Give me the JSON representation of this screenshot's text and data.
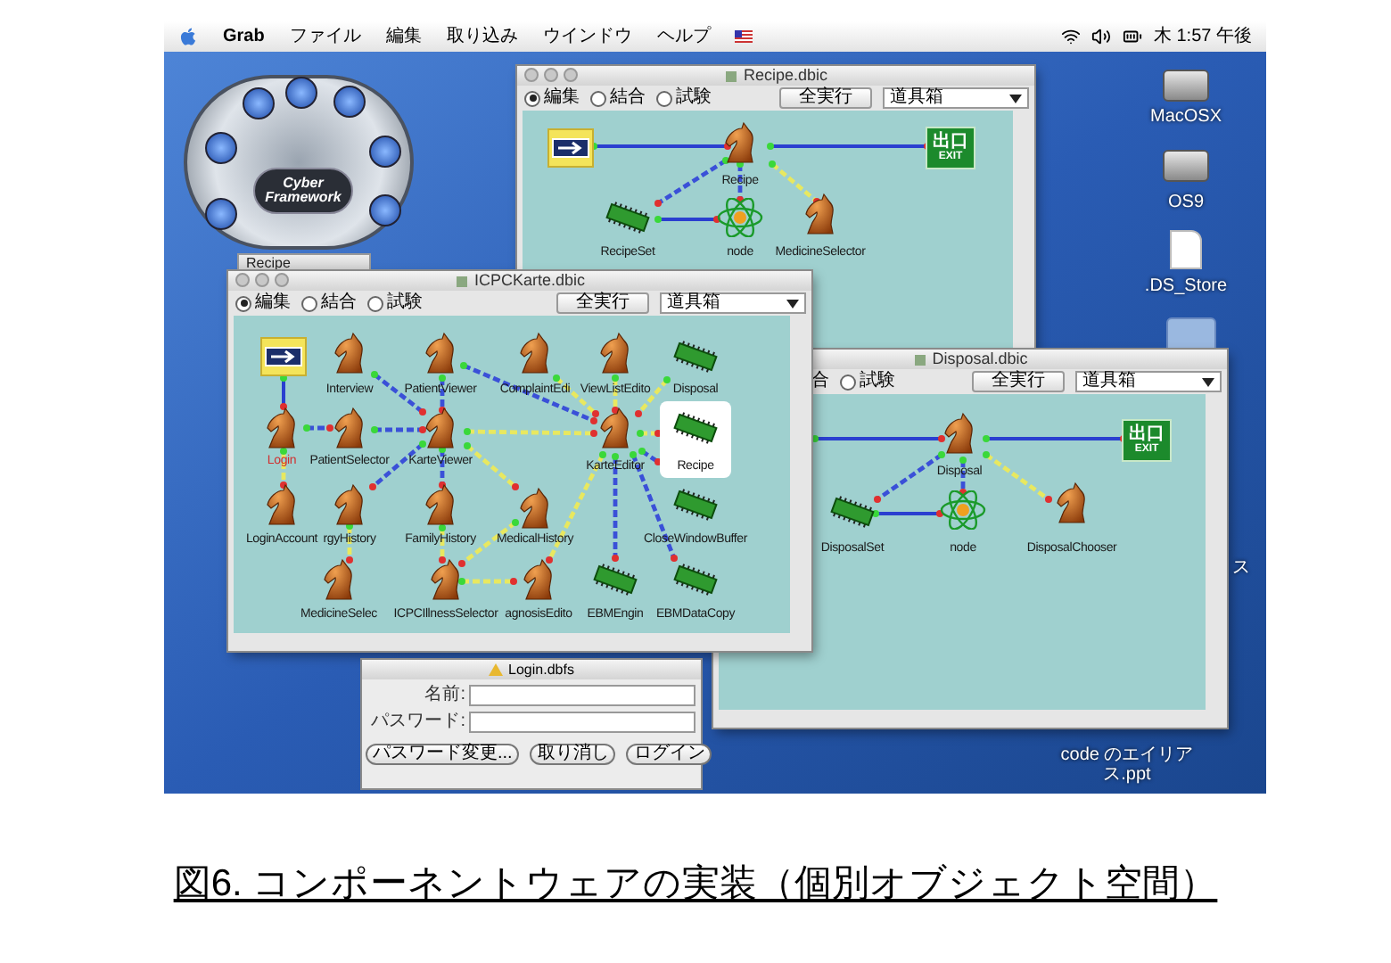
{
  "menu_bar": {
    "app": "Grab",
    "items": [
      "ファイル",
      "編集",
      "取り込み",
      "ウインドウ",
      "ヘルプ"
    ],
    "clock": "木 1:57 午後"
  },
  "palette": {
    "logo": "Cyber Framework",
    "tab": "Recipe"
  },
  "windows": [
    {
      "title": "Recipe.dbic",
      "radios": [
        {
          "label": "編集",
          "selected": true
        },
        {
          "label": "結合",
          "selected": false
        },
        {
          "label": "試験",
          "selected": false
        }
      ],
      "run_button": "全実行",
      "dropdown": "道具箱",
      "nodes": [
        {
          "kind": "start",
          "selected": false
        },
        {
          "kind": "knight",
          "label": "Recipe",
          "selected": false
        },
        {
          "kind": "exit",
          "sign": [
            "出口",
            "EXIT"
          ],
          "selected": false
        },
        {
          "kind": "chip",
          "label": "RecipeSet",
          "selected": false
        },
        {
          "kind": "atom",
          "label": "node",
          "selected": false
        },
        {
          "kind": "knight",
          "label": "MedicineSelector",
          "selected": false
        }
      ]
    },
    {
      "title": "ICPCKarte.dbic",
      "radios": [
        {
          "label": "編集",
          "selected": true
        },
        {
          "label": "結合",
          "selected": false
        },
        {
          "label": "試験",
          "selected": false
        }
      ],
      "run_button": "全実行",
      "dropdown": "道具箱",
      "nodes": [
        {
          "kind": "start",
          "selected": false
        },
        {
          "kind": "knight",
          "label": "Interview",
          "selected": false,
          "color": "#1a1a1a"
        },
        {
          "kind": "knight",
          "label": "PatientViewer",
          "selected": false,
          "color": "#1a1a1a"
        },
        {
          "kind": "knight",
          "label": "ComplaintEdi",
          "selected": false,
          "color": "#1a1a1a"
        },
        {
          "kind": "knight",
          "label": "ViewListEdito",
          "selected": false,
          "color": "#1a1a1a"
        },
        {
          "kind": "chip",
          "label": "Disposal",
          "selected": false,
          "color": "#1a1a1a"
        },
        {
          "kind": "knight",
          "label": "Login",
          "selected": false,
          "color": "#d03030"
        },
        {
          "kind": "knight",
          "label": "PatientSelector",
          "selected": false,
          "color": "#1a1a1a"
        },
        {
          "kind": "knight",
          "label": "KarteViewer",
          "selected": false,
          "color": "#1a1a1a"
        },
        {
          "kind": "knight",
          "label": "KarteEditor",
          "selected": false,
          "color": "#1a1a1a"
        },
        {
          "kind": "chip",
          "label": "Recipe",
          "selected": true,
          "color": "#1a1a1a"
        },
        {
          "kind": "knight",
          "label": "LoginAccount",
          "selected": false,
          "color": "#1a1a1a"
        },
        {
          "kind": "knight",
          "label": "rgyHistory",
          "selected": false,
          "color": "#1a1a1a"
        },
        {
          "kind": "knight",
          "label": "FamilyHistory",
          "selected": false,
          "color": "#1a1a1a"
        },
        {
          "kind": "knight",
          "label": "MedicalHistory",
          "selected": false,
          "color": "#1a1a1a"
        },
        {
          "kind": "chip",
          "label": "CloseWindowBuffer",
          "selected": false,
          "color": "#1a1a1a"
        },
        {
          "kind": "knight",
          "label": "MedicineSelec",
          "selected": false,
          "color": "#1a1a1a"
        },
        {
          "kind": "knight",
          "label": "ICPCIllnessSelector",
          "selected": false,
          "color": "#1a1a1a"
        },
        {
          "kind": "knight",
          "label": "agnosisEdito",
          "selected": false,
          "color": "#1a1a1a"
        },
        {
          "kind": "chip",
          "label": "EBMEngin",
          "selected": false,
          "color": "#1a1a1a"
        },
        {
          "kind": "chip",
          "label": "EBMDataCopy",
          "selected": false,
          "color": "#1a1a1a"
        }
      ]
    },
    {
      "title": "Disposal.dbic",
      "radio_fragment": "合",
      "radios": [
        {
          "label": "試験",
          "selected": false
        }
      ],
      "run_button": "全実行",
      "dropdown": "道具箱",
      "nodes": [
        {
          "kind": "knight",
          "label": "Disposal",
          "selected": false
        },
        {
          "kind": "exit",
          "sign": [
            "出口",
            "EXIT"
          ],
          "selected": false
        },
        {
          "kind": "chip",
          "label": "DisposalSet",
          "selected": false
        },
        {
          "kind": "atom",
          "label": "node",
          "selected": false
        },
        {
          "kind": "knight",
          "label": "DisposalChooser",
          "selected": false
        }
      ]
    }
  ],
  "login": {
    "title": "Login.dbfs",
    "fields": [
      {
        "label": "名前:"
      },
      {
        "label": "パスワード:"
      }
    ],
    "buttons": [
      "パスワード変更...",
      "取り消し",
      "ログイン"
    ]
  },
  "desktop_icons": [
    {
      "kind": "disk",
      "label": "MacOSX"
    },
    {
      "kind": "disk",
      "label": "OS9"
    },
    {
      "kind": "file",
      "label": ".DS_Store"
    },
    {
      "kind": "folder"
    },
    {
      "kind": "none",
      "label": "ス"
    },
    {
      "kind": "none",
      "label": "code のエイリアス.ppt"
    }
  ],
  "caption": "図6. コンポーネントウェアの実装（個別オブジェクト空間）"
}
